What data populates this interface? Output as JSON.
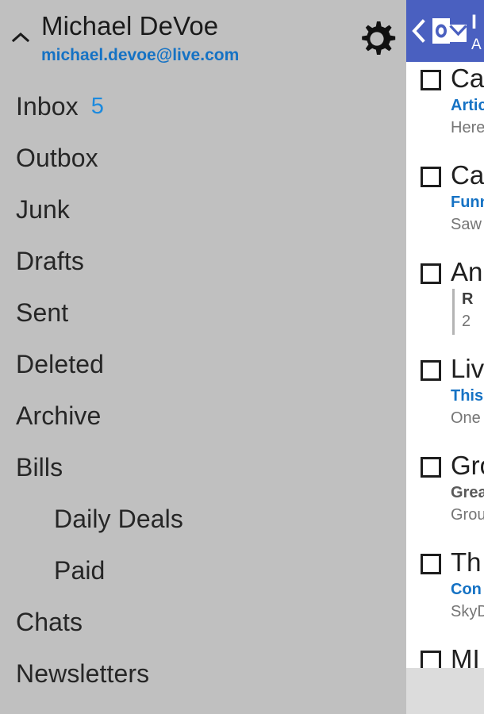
{
  "account": {
    "name": "Michael DeVoe",
    "email": "michael.devoe@live.com",
    "collapse_icon": "chevron-up-icon",
    "settings_icon": "gear-icon"
  },
  "folders": [
    {
      "label": "Inbox",
      "count": "5",
      "sub": false
    },
    {
      "label": "Outbox",
      "count": "",
      "sub": false
    },
    {
      "label": "Junk",
      "count": "",
      "sub": false
    },
    {
      "label": "Drafts",
      "count": "",
      "sub": false
    },
    {
      "label": "Sent",
      "count": "",
      "sub": false
    },
    {
      "label": "Deleted",
      "count": "",
      "sub": false
    },
    {
      "label": "Archive",
      "count": "",
      "sub": false
    },
    {
      "label": "Bills",
      "count": "",
      "sub": false
    },
    {
      "label": "Daily Deals",
      "count": "",
      "sub": true
    },
    {
      "label": "Paid",
      "count": "",
      "sub": true
    },
    {
      "label": "Chats",
      "count": "",
      "sub": false
    },
    {
      "label": "Newsletters",
      "count": "",
      "sub": false
    }
  ],
  "list_pane": {
    "back_icon": "back-chevron-icon",
    "logo_icon": "outlook-logo-icon",
    "title": "I",
    "subtitle": "A",
    "messages": [
      {
        "sender": "Ca",
        "subject": "Artic",
        "preview": "Here",
        "unread": true,
        "thread": false
      },
      {
        "sender": "Ca",
        "subject": "Funn",
        "preview": "Saw",
        "unread": true,
        "thread": false
      },
      {
        "sender": "An",
        "subject": "R",
        "preview": "2",
        "unread": false,
        "thread": true
      },
      {
        "sender": "Liv",
        "subject": "This",
        "preview": "One",
        "unread": true,
        "thread": false
      },
      {
        "sender": "Gro",
        "subject": "Grea",
        "preview": "Grou",
        "unread": false,
        "thread": false
      },
      {
        "sender": "Th",
        "subject": "Con",
        "preview": "SkyD",
        "unread": true,
        "thread": false
      },
      {
        "sender": "MI",
        "subject": "",
        "preview": "",
        "unread": false,
        "thread": false
      }
    ]
  },
  "colors": {
    "sidebar_bg": "#c0c0c0",
    "header_blue": "#4a60c0",
    "accent_blue": "#1572c4",
    "count_blue": "#1c8ade",
    "footer_gray": "#dcdcdc"
  }
}
